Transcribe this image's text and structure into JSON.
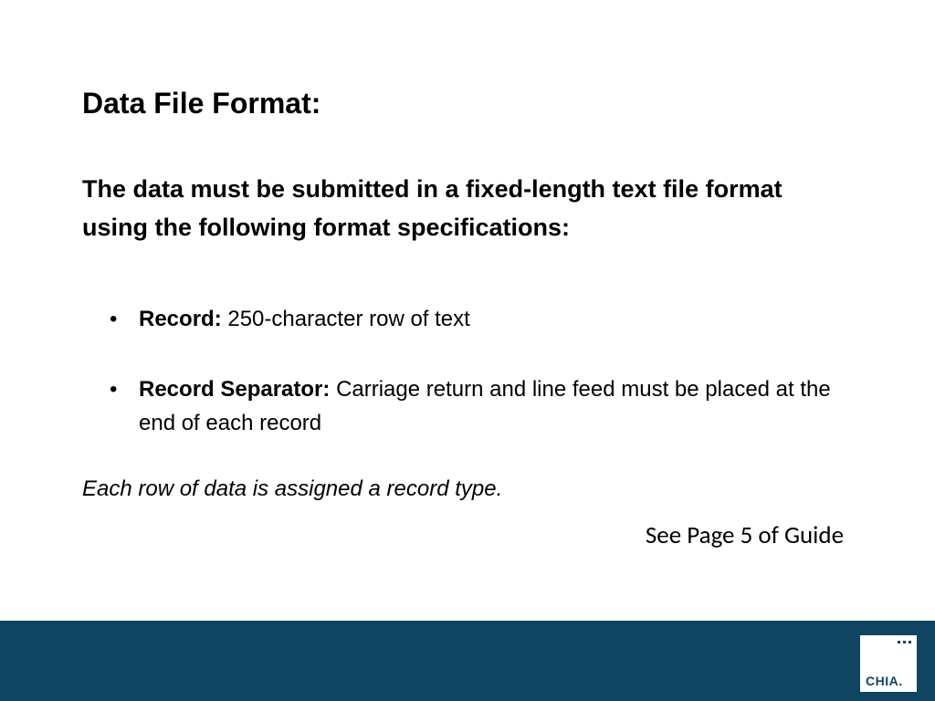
{
  "title": "Data File Format:",
  "subtitle": "The data must be submitted in a fixed-length text file format using the following format specifications:",
  "bullets": [
    {
      "label": "Record:  ",
      "text": "250-character row of text"
    },
    {
      "label": "Record Separator: ",
      "text": "Carriage return and line feed must be placed at the end of each record"
    }
  ],
  "note": "Each row of data is assigned a record type.",
  "page_ref": "See Page 5 of Guide",
  "logo": {
    "text": "CHIA."
  },
  "colors": {
    "footer_bg": "#0f4561",
    "logo_bg": "#ffffff"
  }
}
